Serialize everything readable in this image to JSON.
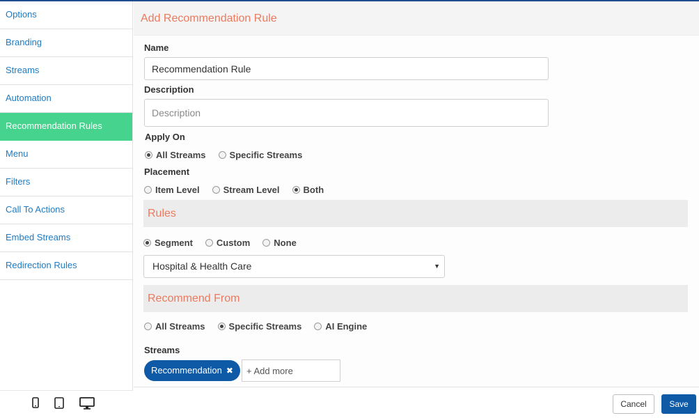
{
  "sidebar": {
    "items": [
      {
        "label": "Options"
      },
      {
        "label": "Branding"
      },
      {
        "label": "Streams"
      },
      {
        "label": "Automation"
      },
      {
        "label": "Recommendation Rules",
        "active": true
      },
      {
        "label": "Menu"
      },
      {
        "label": "Filters"
      },
      {
        "label": "Call To Actions"
      },
      {
        "label": "Embed Streams"
      },
      {
        "label": "Redirection Rules"
      }
    ],
    "active_color": "#45d38e",
    "link_color": "#1e7bc4",
    "devices": [
      "mobile-icon",
      "tablet-icon",
      "desktop-icon"
    ]
  },
  "page": {
    "title": "Add Recommendation Rule",
    "accent_color": "#ec7a5e"
  },
  "form": {
    "name_label": "Name",
    "name_value": "Recommendation Rule",
    "description_label": "Description",
    "description_placeholder": "Description",
    "apply_on": {
      "label": "Apply On",
      "options": [
        "All Streams",
        "Specific Streams"
      ],
      "selected": "All Streams"
    },
    "placement": {
      "label": "Placement",
      "options": [
        "Item Level",
        "Stream Level",
        "Both"
      ],
      "selected": "Both"
    },
    "rules": {
      "section_title": "Rules",
      "options": [
        "Segment",
        "Custom",
        "None"
      ],
      "selected": "Segment",
      "segment_value": "Hospital & Health Care"
    },
    "recommend_from": {
      "section_title": "Recommend From",
      "options": [
        "All Streams",
        "Specific Streams",
        "AI Engine"
      ],
      "selected": "Specific Streams"
    },
    "streams": {
      "label": "Streams",
      "chips": [
        "Recommendation"
      ],
      "add_placeholder": "+ Add more"
    }
  },
  "footer": {
    "cancel_label": "Cancel",
    "save_label": "Save",
    "primary_color": "#0e5aa7"
  }
}
